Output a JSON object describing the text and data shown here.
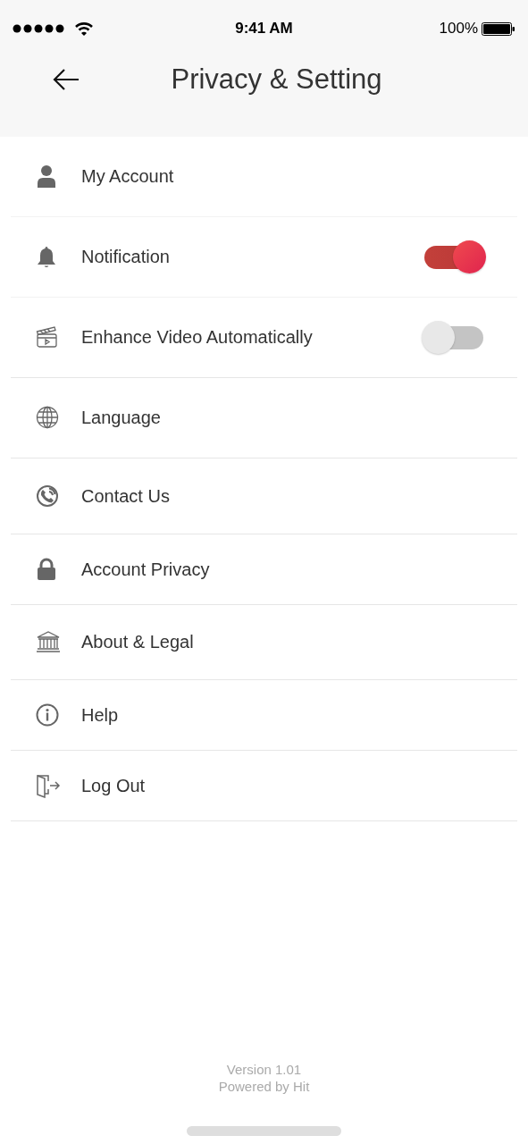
{
  "status_bar": {
    "time": "9:41 AM",
    "battery": "100%"
  },
  "header": {
    "title": "Privacy & Setting"
  },
  "settings": [
    {
      "kind": "link",
      "label": "My Account"
    },
    {
      "kind": "toggle",
      "label": "Notification",
      "on": true
    },
    {
      "kind": "toggle",
      "label": "Enhance Video Automatically",
      "on": false
    },
    {
      "kind": "link",
      "label": "Language"
    },
    {
      "kind": "link",
      "label": "Contact Us"
    },
    {
      "kind": "link",
      "label": "Account Privacy"
    },
    {
      "kind": "link",
      "label": "About & Legal"
    },
    {
      "kind": "link",
      "label": "Help"
    },
    {
      "kind": "link",
      "label": "Log Out"
    }
  ],
  "footer": {
    "version": "Version 1.01",
    "powered_by": "Powered by Hit"
  }
}
